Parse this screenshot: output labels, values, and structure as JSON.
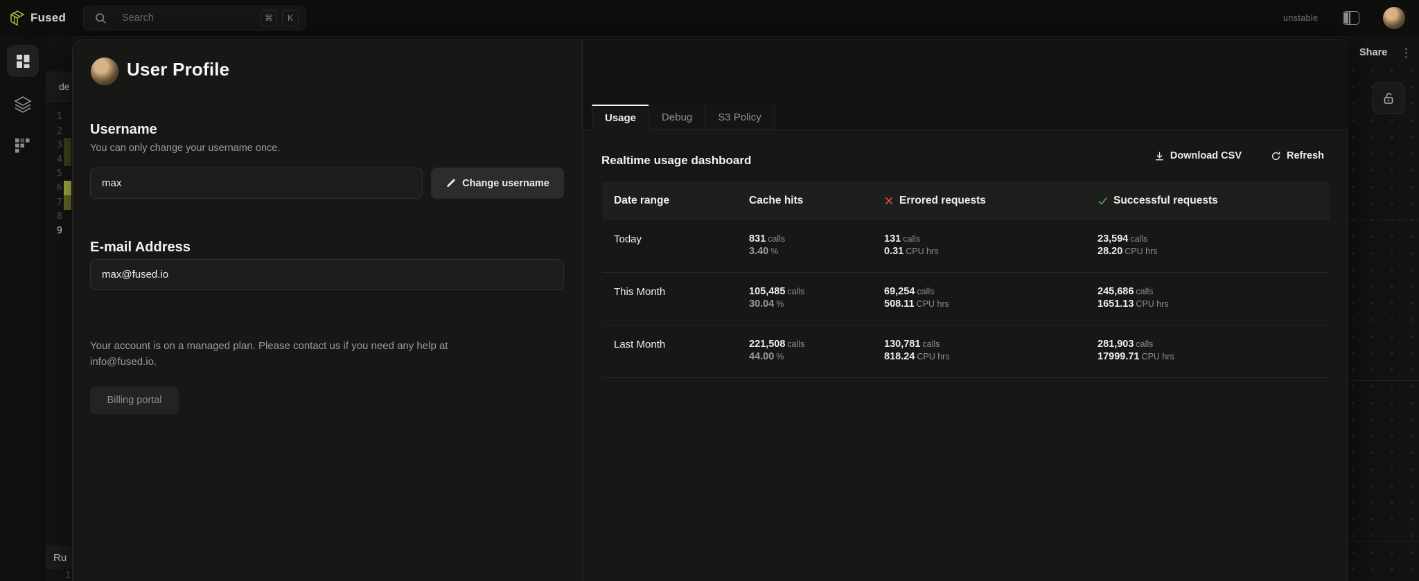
{
  "topbar": {
    "brand": "Fused",
    "search_placeholder": "Search",
    "kbd_cmd": "⌘",
    "kbd_k": "K",
    "env_label": "unstable"
  },
  "editor": {
    "tab_label": "de",
    "lines": [
      "1",
      "2",
      "3",
      "4",
      "5",
      "6",
      "7",
      "8",
      "9"
    ],
    "bottom_panel_label": "Ru",
    "bottom_line": "1"
  },
  "modal": {
    "title": "User Profile",
    "close_glyph": "✕",
    "username": {
      "heading": "Username",
      "helper": "You can only change your username once.",
      "value": "max",
      "button_label": "Change username"
    },
    "email": {
      "heading": "E-mail Address",
      "value": "max@fused.io"
    },
    "plan_text": "Your account is on a managed plan. Please contact us if you need any help at info@fused.io.",
    "billing_button_label": "Billing portal",
    "tabs": [
      {
        "label": "Usage"
      },
      {
        "label": "Debug"
      },
      {
        "label": "S3 Policy"
      }
    ],
    "dashboard": {
      "title": "Realtime usage dashboard",
      "download_label": "Download CSV",
      "refresh_label": "Refresh",
      "table": {
        "columns": [
          "Date range",
          "Cache hits",
          "Errored requests",
          "Successful requests"
        ],
        "units": {
          "calls": "calls",
          "percent": "%",
          "cpu": "CPU hrs"
        },
        "rows": [
          {
            "label": "Today",
            "cache_calls": "831",
            "cache_pct": "3.40",
            "err_calls": "131",
            "err_cpu": "0.31",
            "ok_calls": "23,594",
            "ok_cpu": "28.20"
          },
          {
            "label": "This Month",
            "cache_calls": "105,485",
            "cache_pct": "30.04",
            "err_calls": "69,254",
            "err_cpu": "508.11",
            "ok_calls": "245,686",
            "ok_cpu": "1651.13"
          },
          {
            "label": "Last Month",
            "cache_calls": "221,508",
            "cache_pct": "44.00",
            "err_calls": "130,781",
            "err_cpu": "818.24",
            "ok_calls": "281,903",
            "ok_cpu": "17999.71"
          }
        ]
      }
    }
  },
  "map_panel": {
    "share_label": "Share",
    "kebab_glyph": "⋮"
  },
  "icons": {
    "fused-logo-icon": "isometric-cube",
    "search-icon": "magnifier",
    "layout-columns-icon": "split-panel",
    "workbench-icon": "dashboard-grid",
    "layers-icon": "stacked-layers",
    "modules-icon": "block-grid",
    "edit-pencil-icon": "pencil",
    "download-icon": "arrow-down-tray",
    "refresh-icon": "circular-arrow",
    "error-x-icon": "red-x",
    "success-check-icon": "green-check",
    "lock-open-icon": "open-padlock"
  },
  "colors": {
    "accent": "#b9c13e",
    "error": "#d94f46",
    "success": "#3da35a",
    "modal_bg": "#171716",
    "input_bg": "#1d1d1c"
  }
}
